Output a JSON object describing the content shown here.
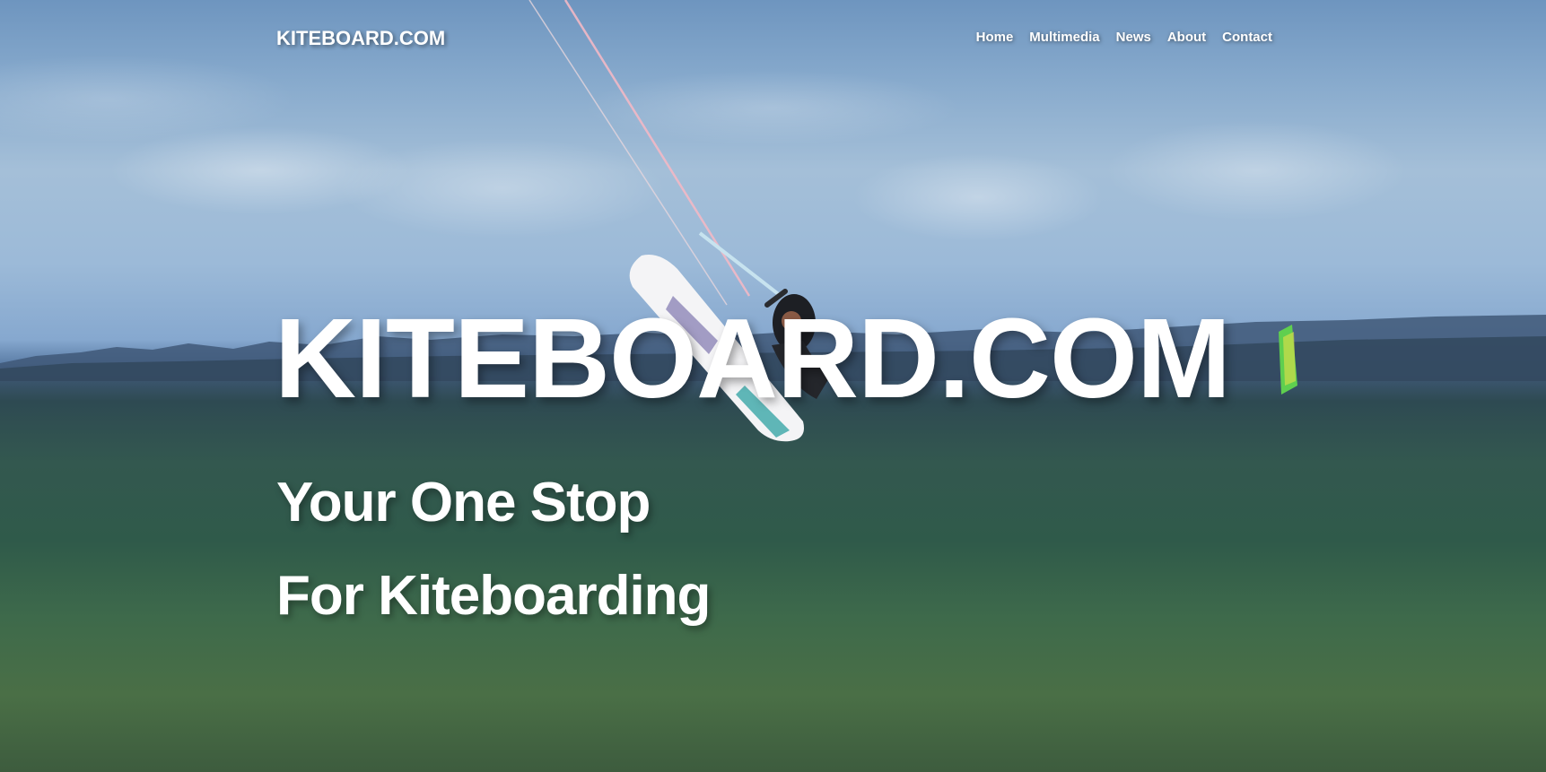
{
  "brand": {
    "label": "KITEBOARD.COM"
  },
  "nav": {
    "items": [
      {
        "label": "Home"
      },
      {
        "label": "Multimedia"
      },
      {
        "label": "News"
      },
      {
        "label": "About"
      },
      {
        "label": "Contact"
      }
    ]
  },
  "hero": {
    "headline": "KITEBOARD.COM",
    "tagline_line1": "Your One Stop",
    "tagline_line2": "For Kiteboarding",
    "background_image": "kiteboarder-jumping-over-ocean-waves-photo"
  },
  "colors": {
    "text": "#ffffff",
    "sky": "#86a9cc",
    "sea": "#2f5a4a",
    "foam": "#ffffff"
  }
}
